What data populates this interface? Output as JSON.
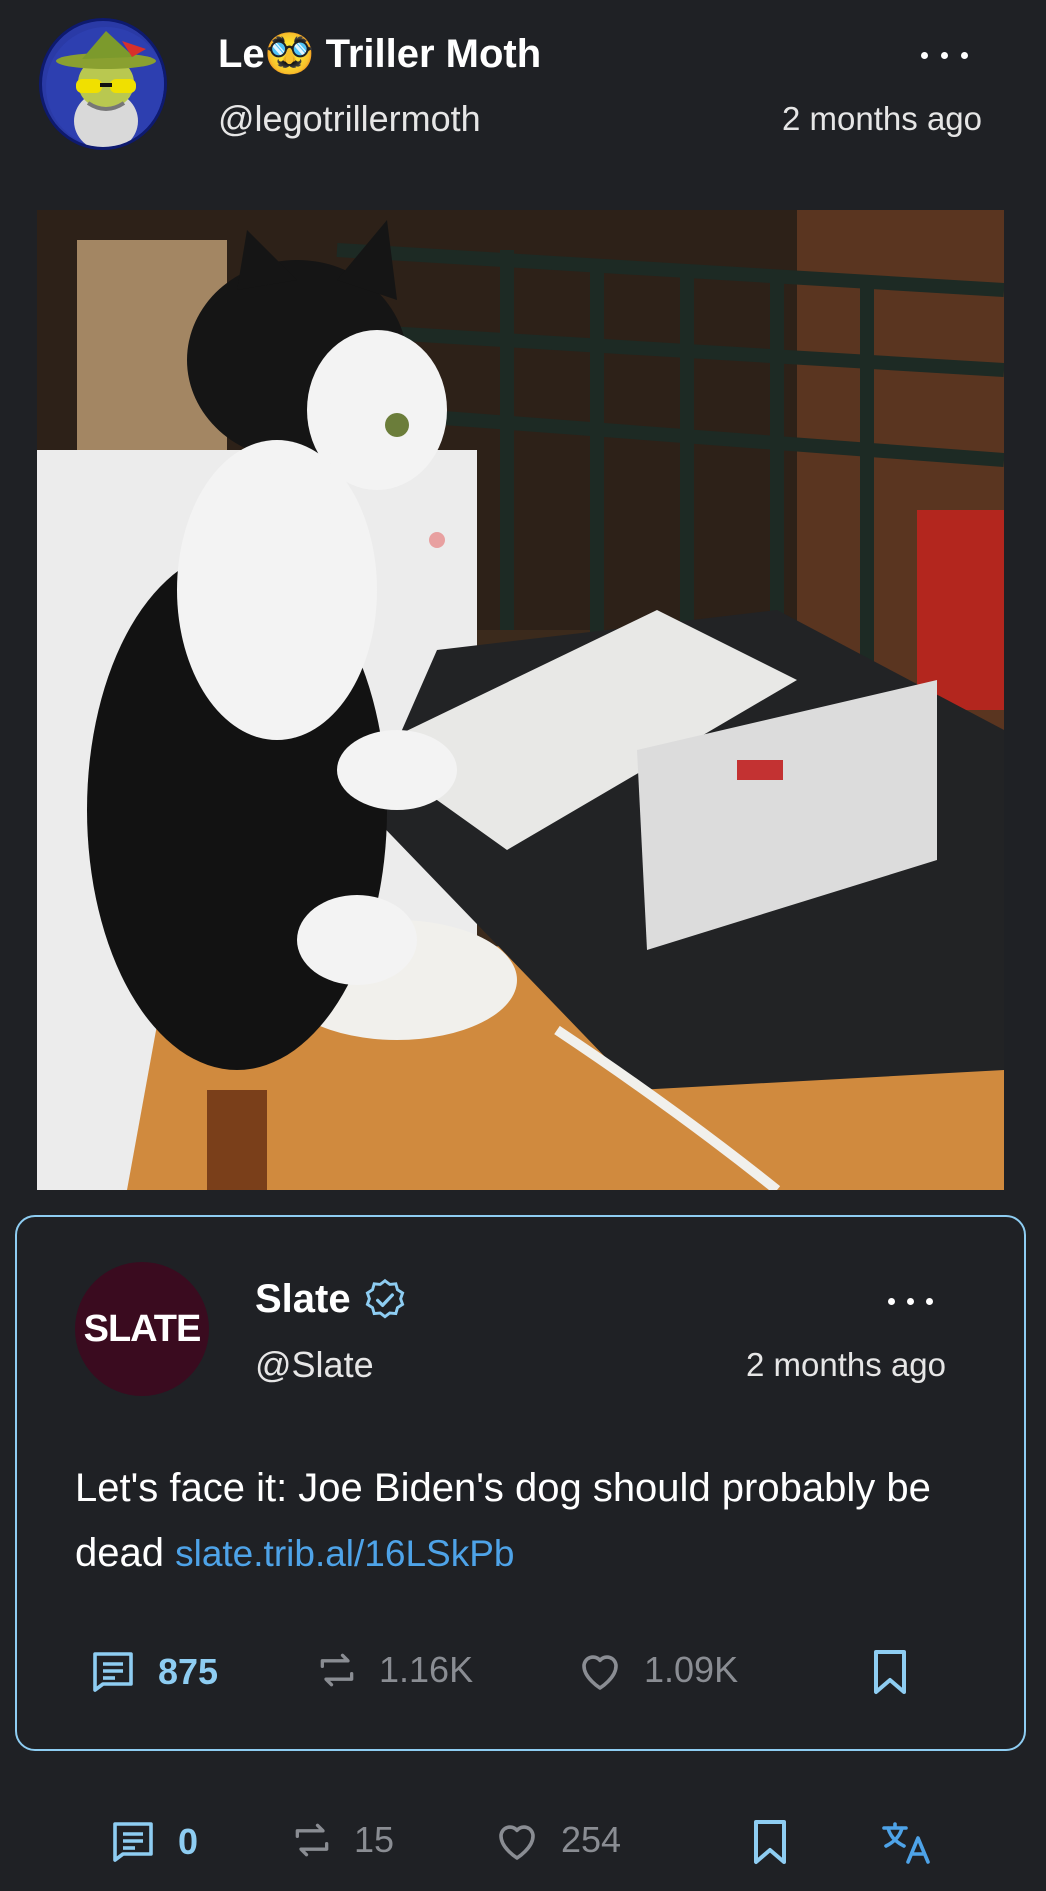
{
  "post": {
    "author_name_prefix": "Le",
    "author_name_emoji": "🥸",
    "author_name_suffix": " Triller Moth",
    "author_handle": "@legotrillermoth",
    "timestamp": "2 months ago",
    "stats": {
      "replies": "0",
      "reposts": "15",
      "likes": "254"
    }
  },
  "quote": {
    "logo_text": "SLATE",
    "author_name": "Slate",
    "author_handle": "@Slate",
    "timestamp": "2 months ago",
    "text": "Let's face it: Joe Biden's dog should probably be dead",
    "link": "slate.trib.al/16LSkPb",
    "stats": {
      "replies": "875",
      "reposts": "1.16K",
      "likes": "1.09K"
    }
  },
  "colors": {
    "background": "#1f2125",
    "card_border": "#8ecdf2",
    "link": "#4ea3e8",
    "reply_count_accent": "#8ecdf2",
    "muted_stat": "#8a8d93"
  }
}
